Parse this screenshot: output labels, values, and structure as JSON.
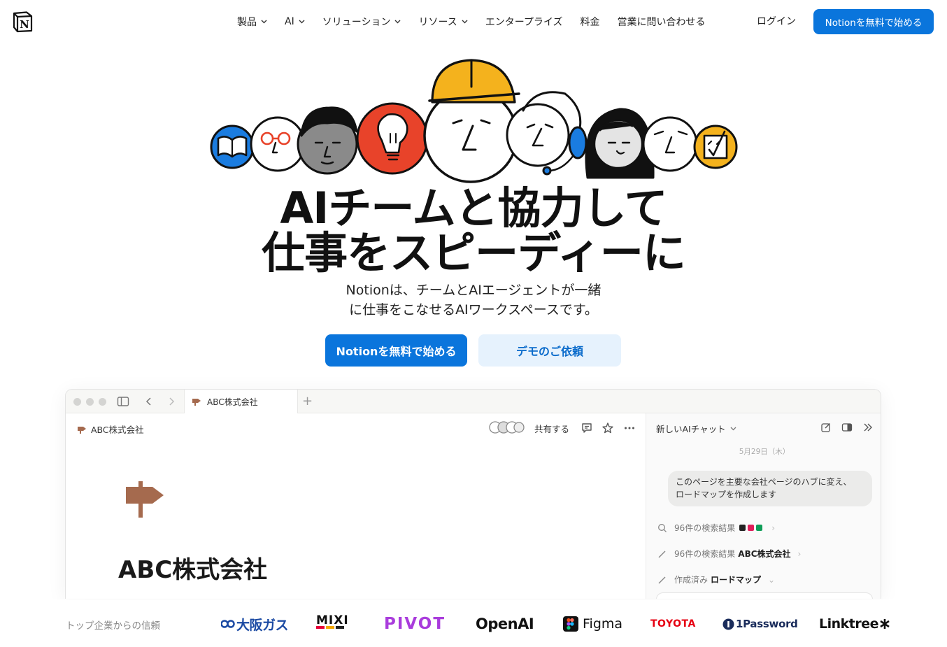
{
  "header": {
    "nav": [
      {
        "label": "製品",
        "has_dropdown": true
      },
      {
        "label": "AI",
        "has_dropdown": true
      },
      {
        "label": "ソリューション",
        "has_dropdown": true
      },
      {
        "label": "リソース",
        "has_dropdown": true
      },
      {
        "label": "エンタープライズ",
        "has_dropdown": false
      },
      {
        "label": "料金",
        "has_dropdown": false
      },
      {
        "label": "営業に問い合わせる",
        "has_dropdown": false
      }
    ],
    "login_label": "ログイン",
    "cta_label": "Notionを無料で始める"
  },
  "hero": {
    "headline_line1": "AIチームと協力して",
    "headline_line2": "仕事をスピーディーに",
    "sub_line1": "Notionは、チームとAIエージェントが一緒",
    "sub_line2": "に仕事をこなせるAIワークスペースです。",
    "primary_button": "Notionを無料で始める",
    "secondary_button": "デモのご依頼"
  },
  "app": {
    "tab_label": "ABC株式会社",
    "breadcrumb": "ABC株式会社",
    "share_label": "共有する",
    "page_title": "ABC株式会社",
    "ai": {
      "title": "新しいAIチャット",
      "date": "5月29日（木）",
      "message_line1": "このページを主要な会社ページのハブに変え、",
      "message_line2": "ロードマップを作成します",
      "step1_text": "96件の検索結果",
      "step2_text": "96件の検索結果",
      "step2_bold": "ABC株式会社",
      "step3_text": "作成済み",
      "step3_bold": "ロードマップ"
    }
  },
  "trust": {
    "label": "トップ企業からの信頼",
    "logos": [
      "大阪ガス",
      "MIXI",
      "PIVOT",
      "OpenAI",
      "Figma",
      "TOYOTA",
      "1Password",
      "Linktree"
    ]
  },
  "colors": {
    "accent": "#0a75dc",
    "secondary_bg": "#e6f2fd",
    "sign_brown": "#a56a4e",
    "bulb_red": "#e8432a",
    "hardhat_yellow": "#f4b21d",
    "book_blue": "#1a7ce0"
  },
  "icons": [
    "notion-logo-icon",
    "chevron-down-icon",
    "sidebar-toggle-icon",
    "back-icon",
    "forward-icon",
    "signpost-icon",
    "plus-icon",
    "comment-icon",
    "star-icon",
    "more-icon",
    "edit-icon",
    "panel-icon",
    "collapse-icon",
    "search-icon",
    "pencil-icon"
  ]
}
